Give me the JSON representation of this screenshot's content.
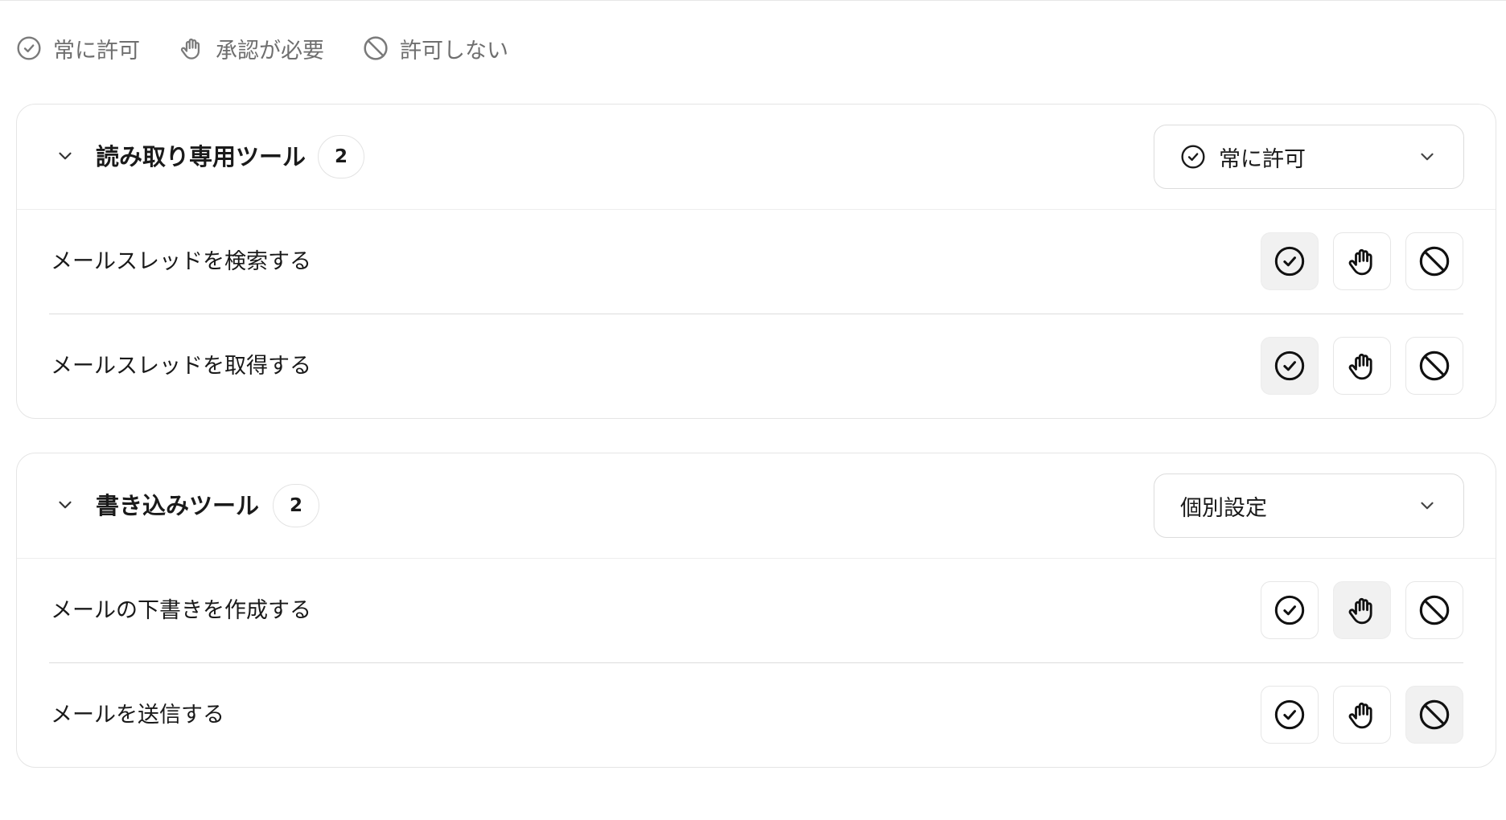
{
  "legend": {
    "always_allow": "常に許可",
    "needs_approval": "承認が必要",
    "never_allow": "許可しない"
  },
  "groups": [
    {
      "title": "読み取り専用ツール",
      "count": "2",
      "mode": "常に許可",
      "mode_icon": "check-circle-icon",
      "tools": [
        {
          "name": "メールスレッドを検索する",
          "selected": "always_allow"
        },
        {
          "name": "メールスレッドを取得する",
          "selected": "always_allow"
        }
      ]
    },
    {
      "title": "書き込みツール",
      "count": "2",
      "mode": "個別設定",
      "mode_icon": "",
      "tools": [
        {
          "name": "メールの下書きを作成する",
          "selected": "needs_approval"
        },
        {
          "name": "メールを送信する",
          "selected": "never_allow"
        }
      ]
    }
  ],
  "colors": {
    "selected_bg": "#f1f1f1",
    "border": "#e5e5e5",
    "muted_text": "#6f6f6f"
  }
}
